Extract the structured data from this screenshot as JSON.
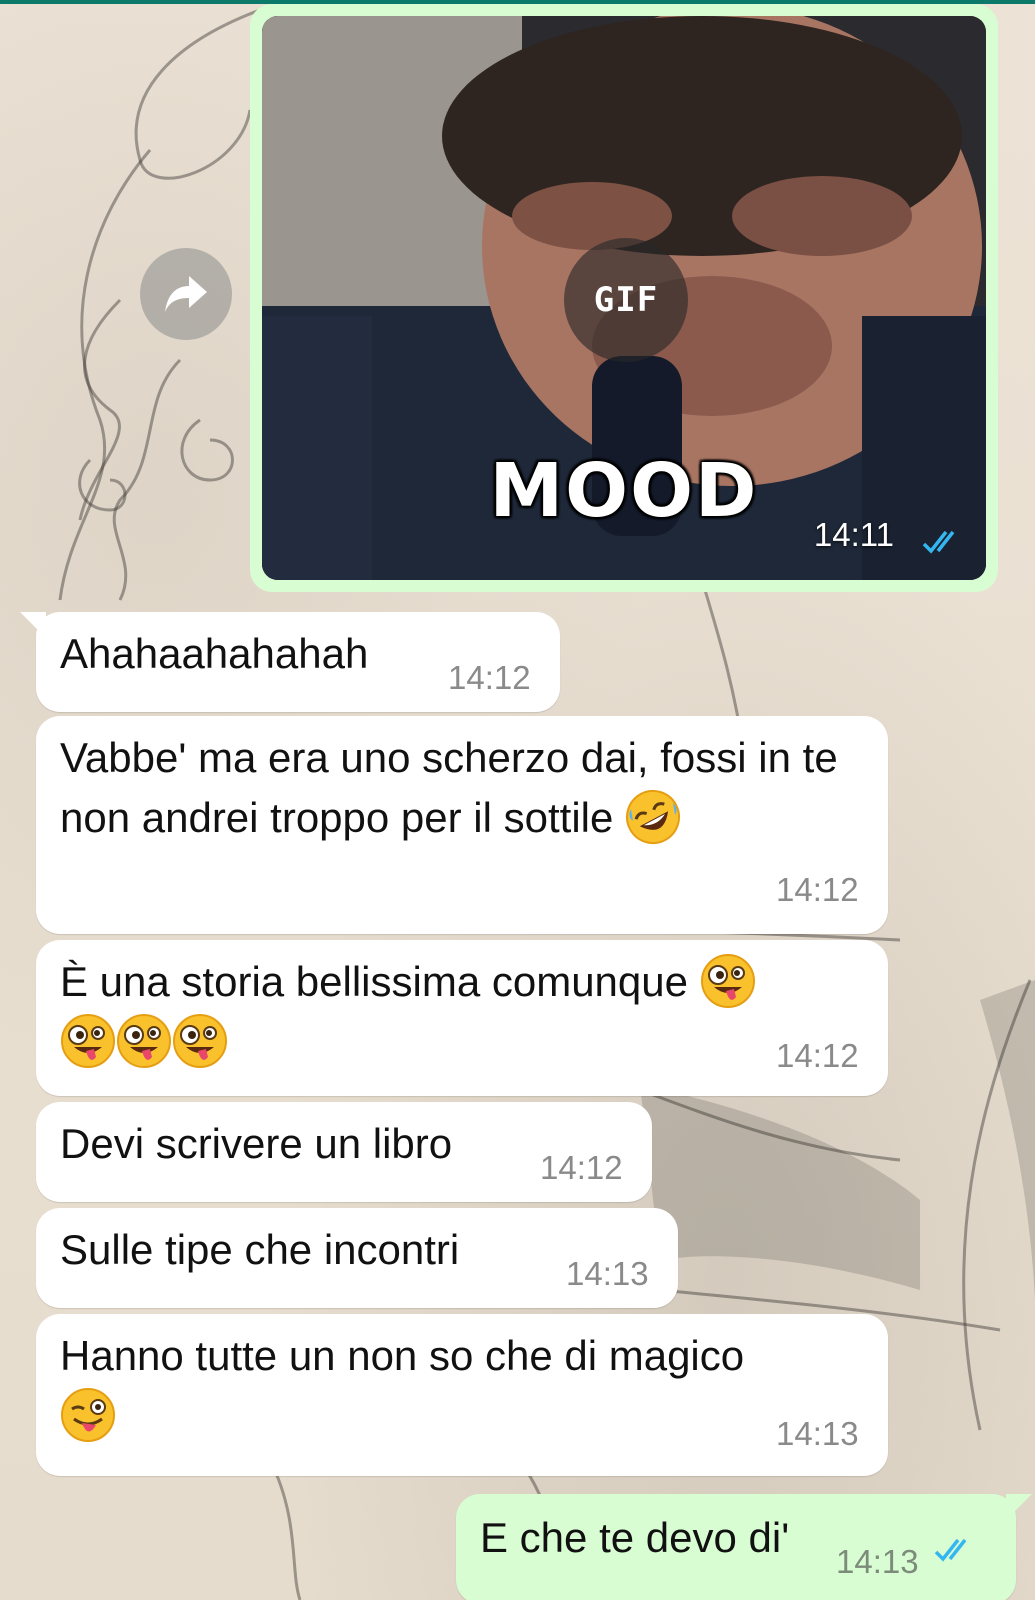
{
  "colors": {
    "outgoing_bubble": "#d9fdd3",
    "incoming_bubble": "#ffffff",
    "read_ticks": "#34b7f1",
    "timestamp": "#8a8a8a"
  },
  "gif_message": {
    "badge": "GIF",
    "caption": "MOOD",
    "time": "14:11",
    "status_icon": "double-check-read-icon"
  },
  "forward_icon": "forward-arrow-icon",
  "messages": [
    {
      "text": "Ahahaahahahah",
      "time": "14:12"
    },
    {
      "text": "Vabbe' ma era uno scherzo dai, fossi in te non andrei troppo per il sottile",
      "emoji": "rolling-on-floor-laughing-emoji",
      "time": "14:12"
    },
    {
      "text": "È una storia bellissima comunque",
      "emoji": "zany-face-emoji",
      "extra_emoji_count": 3,
      "time": "14:12"
    },
    {
      "text": "Devi scrivere un libro",
      "time": "14:12"
    },
    {
      "text": "Sulle tipe che incontri",
      "time": "14:13"
    },
    {
      "text": "Hanno tutte un non so che di magico",
      "emoji": "winking-face-with-tongue-emoji",
      "time": "14:13"
    }
  ],
  "outgoing_message": {
    "text": "E che te devo di'",
    "time": "14:13",
    "status_icon": "double-check-read-icon"
  }
}
